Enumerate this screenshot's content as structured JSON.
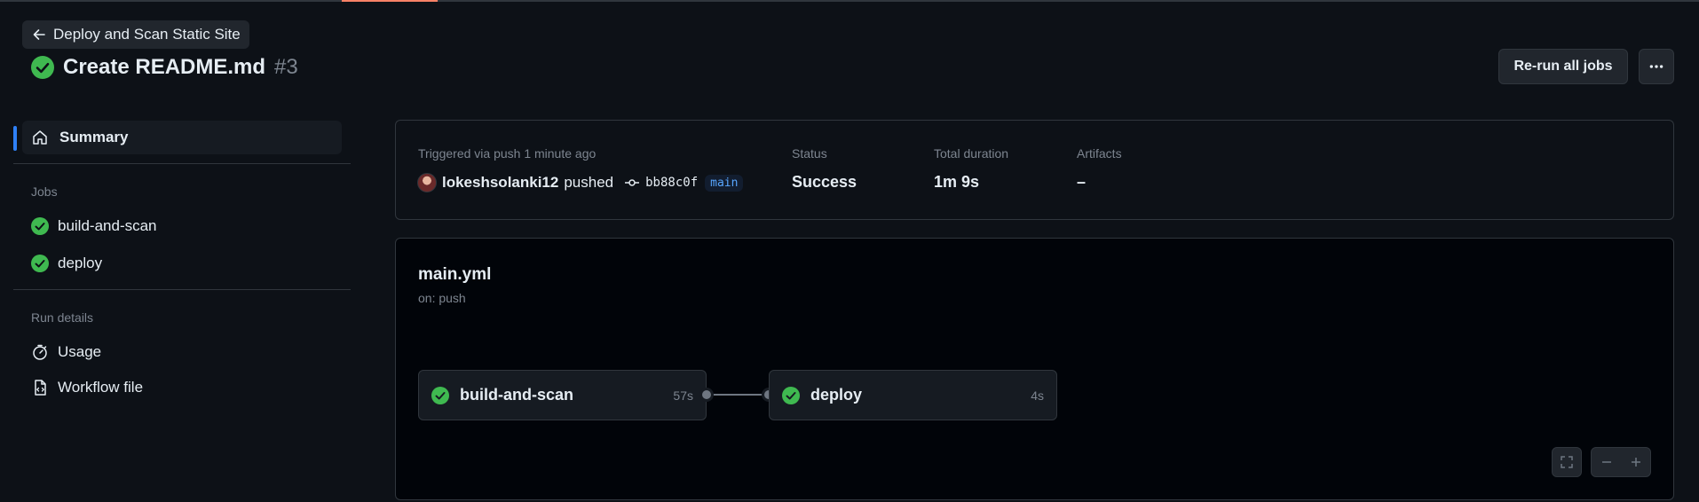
{
  "header": {
    "back_label": "Deploy and Scan Static Site",
    "title": "Create README.md",
    "run_number": "#3",
    "rerun_label": "Re-run all jobs"
  },
  "sidebar": {
    "summary_label": "Summary",
    "jobs_heading": "Jobs",
    "jobs": [
      {
        "label": "build-and-scan"
      },
      {
        "label": "deploy"
      }
    ],
    "run_details_heading": "Run details",
    "details": [
      {
        "label": "Usage",
        "icon": "stopwatch-icon"
      },
      {
        "label": "Workflow file",
        "icon": "file-code-icon"
      }
    ]
  },
  "summary": {
    "trigger_text": "Triggered via push 1 minute ago",
    "user": "lokeshsolanki12",
    "action": "pushed",
    "commit_sha": "bb88c0f",
    "branch": "main",
    "status_label": "Status",
    "status_value": "Success",
    "duration_label": "Total duration",
    "duration_value": "1m 9s",
    "artifacts_label": "Artifacts",
    "artifacts_value": "–"
  },
  "workflow": {
    "file_name": "main.yml",
    "trigger": "on: push",
    "jobs": [
      {
        "name": "build-and-scan",
        "duration": "57s"
      },
      {
        "name": "deploy",
        "duration": "4s"
      }
    ]
  },
  "colors": {
    "success": "#3fb950",
    "accent": "#2f81f7",
    "tab_underline": "#f78166"
  }
}
